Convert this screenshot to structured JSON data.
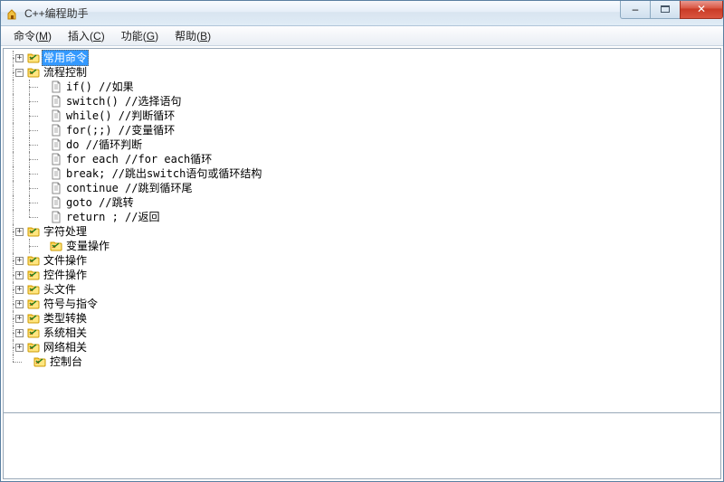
{
  "window": {
    "title": "C++编程助手"
  },
  "menu": {
    "items": [
      {
        "label": "命令",
        "accel": "M"
      },
      {
        "label": "插入",
        "accel": "C"
      },
      {
        "label": "功能",
        "accel": "G"
      },
      {
        "label": "帮助",
        "accel": "B"
      }
    ]
  },
  "win_controls": {
    "min": "–",
    "max": "□",
    "close": "✕"
  },
  "tree": {
    "nodes": [
      {
        "kind": "folder",
        "label": "常用命令",
        "state": "collapsed",
        "selected": true,
        "depth": 0
      },
      {
        "kind": "folder",
        "label": "流程控制",
        "state": "expanded",
        "depth": 0,
        "children": [
          {
            "kind": "file",
            "label": "if() //如果"
          },
          {
            "kind": "file",
            "label": "switch() //选择语句"
          },
          {
            "kind": "file",
            "label": "while() //判断循环"
          },
          {
            "kind": "file",
            "label": "for(;;) //变量循环"
          },
          {
            "kind": "file",
            "label": "do //循环判断"
          },
          {
            "kind": "file",
            "label": "for each //for each循环"
          },
          {
            "kind": "file",
            "label": "break; //跳出switch语句或循环结构"
          },
          {
            "kind": "file",
            "label": "continue //跳到循环尾"
          },
          {
            "kind": "file",
            "label": "goto //跳转"
          },
          {
            "kind": "file",
            "label": "return ; //返回"
          }
        ]
      },
      {
        "kind": "folder",
        "label": "字符处理",
        "state": "collapsed",
        "depth": 0
      },
      {
        "kind": "folder",
        "label": "变量操作",
        "state": "none",
        "depth": 1,
        "noexp": true
      },
      {
        "kind": "folder",
        "label": "文件操作",
        "state": "collapsed",
        "depth": 0
      },
      {
        "kind": "folder",
        "label": "控件操作",
        "state": "collapsed",
        "depth": 0
      },
      {
        "kind": "folder",
        "label": "头文件",
        "state": "collapsed",
        "depth": 0
      },
      {
        "kind": "folder",
        "label": "符号与指令",
        "state": "collapsed",
        "depth": 0
      },
      {
        "kind": "folder",
        "label": "类型转换",
        "state": "collapsed",
        "depth": 0
      },
      {
        "kind": "folder",
        "label": "系统相关",
        "state": "collapsed",
        "depth": 0
      },
      {
        "kind": "folder",
        "label": "网络相关",
        "state": "collapsed",
        "depth": 0
      },
      {
        "kind": "folder",
        "label": "控制台",
        "state": "none",
        "depth": 0,
        "noexp": true,
        "last": true
      }
    ]
  }
}
